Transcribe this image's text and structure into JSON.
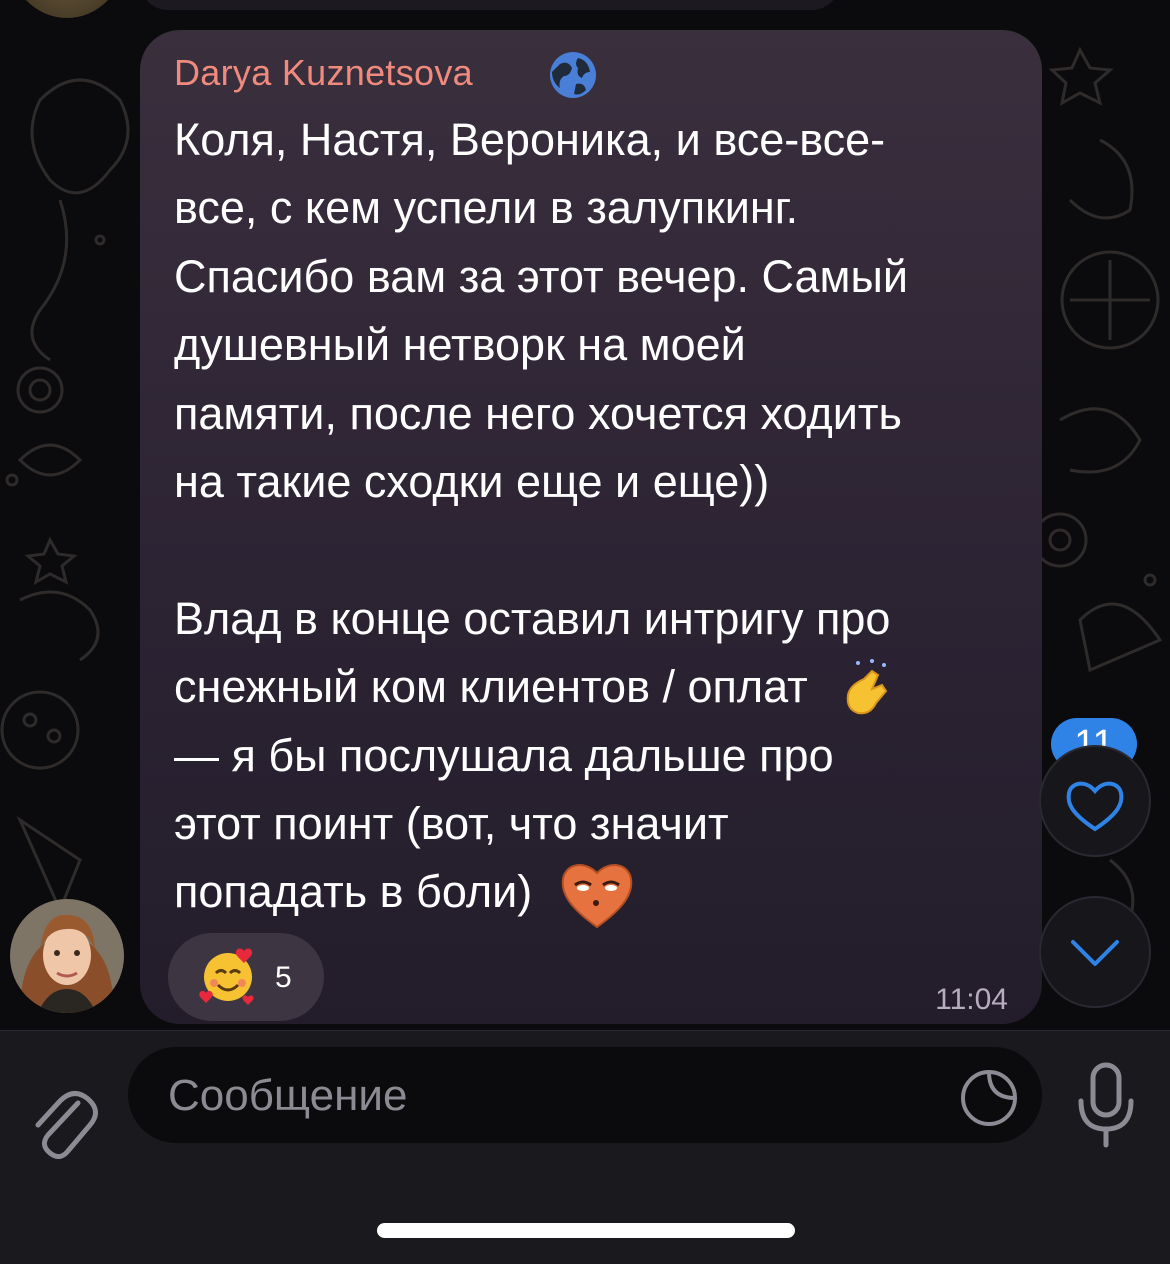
{
  "message": {
    "sender": "Darya Kuznetsova",
    "sender_color": "#f08a7d",
    "sender_badge_icon": "globe-icon",
    "lines": [
      "Коля, Настя, Вероника, и все-все-",
      "все, с кем успели в залупкинг.",
      "Спасибо вам за этот вечер. Самый",
      "душевный нетворк на моей",
      "памяти, после него хочется ходить",
      "на такие сходки еще и еще))",
      "",
      "Влад в конце оставил интригу про",
      "снежный ком клиентов / оплат",
      "— я бы послушала дальше про",
      "этот поинт (вот, что значит",
      "попадать в боли)"
    ],
    "inline_emojis": [
      "crossed-fingers-emoji",
      "heart-face-emoji"
    ],
    "time": "11:04",
    "reaction": {
      "emoji": "smiling-face-with-hearts-emoji",
      "count": "5"
    }
  },
  "side": {
    "reactions_badge": "11",
    "reactions_icon": "heart-icon",
    "scroll_icon": "chevron-down-icon",
    "accent": "#2f83e6"
  },
  "composer": {
    "placeholder": "Сообщение",
    "attach_icon": "paperclip-icon",
    "sticker_icon": "sticker-icon",
    "mic_icon": "microphone-icon"
  }
}
